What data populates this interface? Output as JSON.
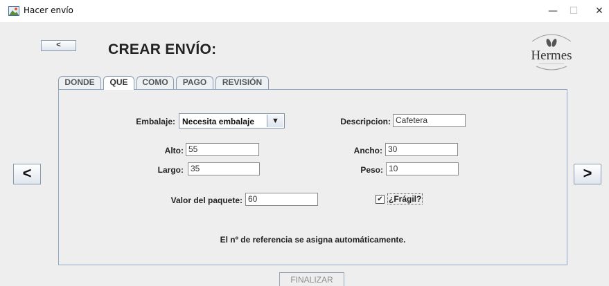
{
  "window": {
    "title": "Hacer envío",
    "controls": {
      "minimize": "—",
      "maximize": "☐",
      "close": "✕"
    }
  },
  "header": {
    "back_label": "<",
    "title": "CREAR ENVÍO:",
    "logo_text": "Hermes"
  },
  "tabs": [
    {
      "label": "DONDE",
      "active": false
    },
    {
      "label": "QUE",
      "active": true
    },
    {
      "label": "COMO",
      "active": false
    },
    {
      "label": "PAGO",
      "active": false
    },
    {
      "label": "REVISIÓN",
      "active": false
    }
  ],
  "form": {
    "embalaje": {
      "label": "Embalaje:",
      "value": "Necesita embalaje",
      "arrow": "▼"
    },
    "descripcion": {
      "label": "Descripcion:",
      "value": "Cafetera"
    },
    "alto": {
      "label": "Alto:",
      "value": "55"
    },
    "ancho": {
      "label": "Ancho:",
      "value": "30"
    },
    "largo": {
      "label": "Largo:",
      "value": "35"
    },
    "peso": {
      "label": "Peso:",
      "value": "10"
    },
    "valor": {
      "label": "Valor del paquete:",
      "value": "60"
    },
    "fragil": {
      "label": "¿Frágil?",
      "checked": true,
      "check_glyph": "✔"
    },
    "notice": "El nº de referencia se asigna automáticamente."
  },
  "navigation": {
    "prev_label": "<",
    "next_label": ">",
    "finish_label": "FINALIZAR"
  },
  "colors": {
    "panel_border": "#8fa7c6",
    "background": "#eeeeee"
  }
}
